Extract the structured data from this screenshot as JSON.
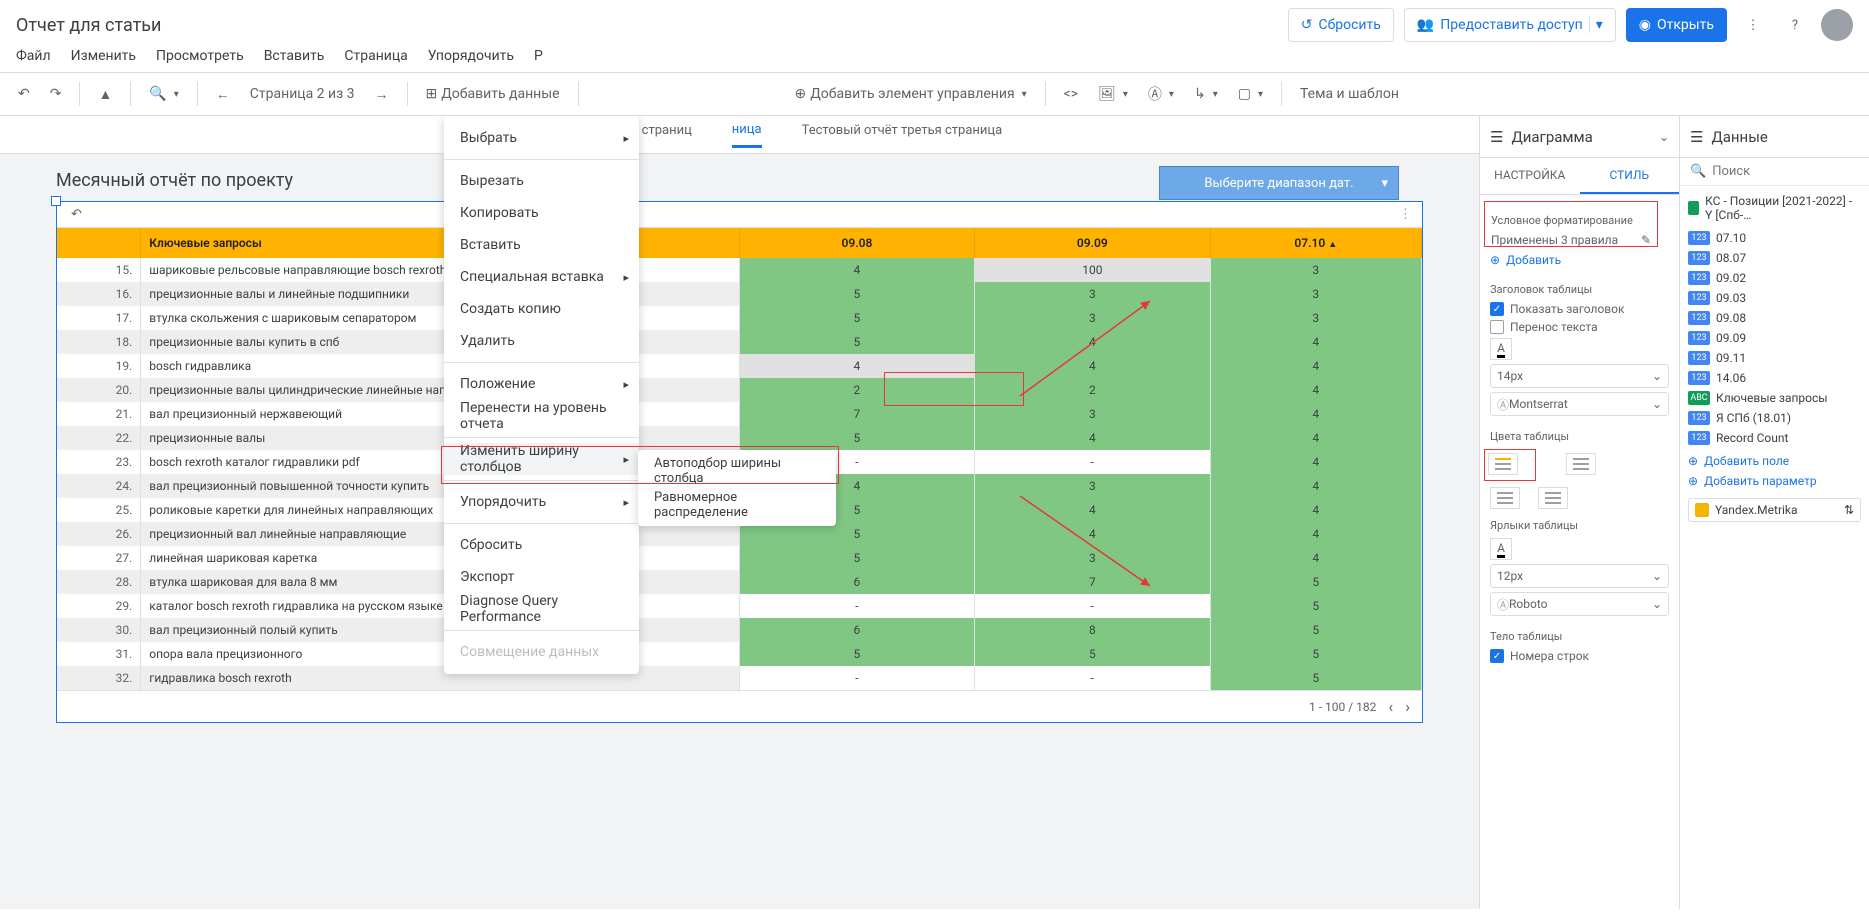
{
  "title": "Отчет для статьи",
  "menu": [
    "Файл",
    "Изменить",
    "Просмотреть",
    "Вставить",
    "Страница",
    "Упорядочить",
    "Р"
  ],
  "hdr_btns": {
    "reset": "Сбросить",
    "share": "Предоставить доступ",
    "open": "Открыть"
  },
  "toolbar": {
    "page": "Страница 2 из 3",
    "add_data": "Добавить данные",
    "add_control": "Добавить элемент управления",
    "theme": "Тема и шаблон"
  },
  "page_tabs": [
    "Тестовый отчёт титульная страниц",
    "ница",
    "Тестовый отчёт третья страница"
  ],
  "report_title": "Месячный отчёт по проекту",
  "date_picker": "Выберите диапазон дат.",
  "th": {
    "kw": "Ключевые запросы",
    "c1": "09.08",
    "c2": "09.09",
    "c3": "07.10"
  },
  "rows": [
    {
      "i": "15.",
      "k": "шариковые рельсовые направляющие bosch rexroth",
      "a": "4",
      "b": "100",
      "c": "3",
      "bs": "gr"
    },
    {
      "i": "16.",
      "k": "прецизионные валы и линейные подшипники",
      "a": "5",
      "b": "3",
      "c": "3"
    },
    {
      "i": "17.",
      "k": "втулка скольжения с шариковым сепаратором",
      "a": "5",
      "b": "3",
      "c": "3"
    },
    {
      "i": "18.",
      "k": "прецизионные валы купить в спб",
      "a": "5",
      "b": "4",
      "c": "4"
    },
    {
      "i": "19.",
      "k": "bosch гидравлика",
      "a": "4",
      "b": "4",
      "c": "4",
      "as": "gr"
    },
    {
      "i": "20.",
      "k": "прецизионные валы цилиндрические линейные направляющ",
      "a": "2",
      "b": "2",
      "c": "4"
    },
    {
      "i": "21.",
      "k": "вал прецизионный нержавеющий",
      "a": "7",
      "b": "3",
      "c": "4"
    },
    {
      "i": "22.",
      "k": "прецизионные валы",
      "a": "5",
      "b": "4",
      "c": "4"
    },
    {
      "i": "23.",
      "k": "bosch rexroth каталог гидравлики pdf",
      "a": "-",
      "b": "-",
      "c": "4",
      "as": "w",
      "bs": "w"
    },
    {
      "i": "24.",
      "k": "вал прецизионный повышенной точности купить",
      "a": "4",
      "b": "3",
      "c": "4"
    },
    {
      "i": "25.",
      "k": "роликовые каретки для линейных направляющих",
      "a": "5",
      "b": "4",
      "c": "4"
    },
    {
      "i": "26.",
      "k": "прецизионный вал линейные направляющие",
      "a": "5",
      "b": "4",
      "c": "4"
    },
    {
      "i": "27.",
      "k": "линейная шариковая каретка",
      "a": "5",
      "b": "3",
      "c": "4"
    },
    {
      "i": "28.",
      "k": "втулка шариковая для вала 8 мм",
      "a": "6",
      "b": "7",
      "c": "5"
    },
    {
      "i": "29.",
      "k": "каталог bosch rexroth гидравлика на русском языке",
      "a": "-",
      "b": "-",
      "c": "5",
      "as": "w",
      "bs": "w"
    },
    {
      "i": "30.",
      "k": "вал прецизионный полый купить",
      "a": "6",
      "b": "8",
      "c": "5"
    },
    {
      "i": "31.",
      "k": "опора вала прецизионного",
      "a": "5",
      "b": "5",
      "c": "5"
    },
    {
      "i": "32.",
      "k": "гидравлика bosch rexroth",
      "a": "-",
      "b": "-",
      "c": "5",
      "as": "w",
      "bs": "w"
    }
  ],
  "pager": "1 - 100 / 182",
  "ctx": {
    "select": "Выбрать",
    "cut": "Вырезать",
    "copy": "Копировать",
    "paste": "Вставить",
    "paste_special": "Специальная вставка",
    "dup": "Создать копию",
    "del": "Удалить",
    "position": "Положение",
    "to_report": "Перенести на уровень отчета",
    "col_width": "Изменить ширину столбцов",
    "order": "Упорядочить",
    "reset": "Сбросить",
    "export": "Экспорт",
    "diag": "Diagnose Query Performance",
    "blend": "Совмещение данных",
    "sub_auto": "Автоподбор ширины столбца",
    "sub_even": "Равномерное распределение"
  },
  "sb": {
    "chart": "Диаграмма",
    "tab_setup": "НАСТРОЙКА",
    "tab_style": "СТИЛЬ",
    "cond_fmt": "Условное форматирование",
    "rules": "Применены 3 правила",
    "add": "Добавить",
    "sec_header": "Заголовок таблицы",
    "show_header": "Показать заголовок",
    "wrap": "Перенос текста",
    "fs1": "14px",
    "font1": "Montserrat",
    "sec_colors": "Цвета таблицы",
    "sec_labels": "Ярлыки таблицы",
    "fs2": "12px",
    "font2": "Roboto",
    "sec_body": "Тело таблицы",
    "rownum": "Номера строк"
  },
  "dp": {
    "title": "Данные",
    "search": "Поиск",
    "src": "КС - Позиции [2021-2022] - Y [Спб-…",
    "fields": [
      {
        "t": "num",
        "l": "07.10"
      },
      {
        "t": "num",
        "l": "08.07"
      },
      {
        "t": "num",
        "l": "09.02"
      },
      {
        "t": "num",
        "l": "09.03"
      },
      {
        "t": "num",
        "l": "09.08"
      },
      {
        "t": "num",
        "l": "09.09"
      },
      {
        "t": "num",
        "l": "09.11"
      },
      {
        "t": "num",
        "l": "14.06"
      },
      {
        "t": "txt",
        "l": "Ключевые запросы"
      },
      {
        "t": "num",
        "l": "Я СПб (18.01)"
      },
      {
        "t": "num",
        "l": "Record Count"
      }
    ],
    "add_field": "Добавить поле",
    "add_param": "Добавить параметр",
    "ym": "Yandex.Metrika"
  }
}
